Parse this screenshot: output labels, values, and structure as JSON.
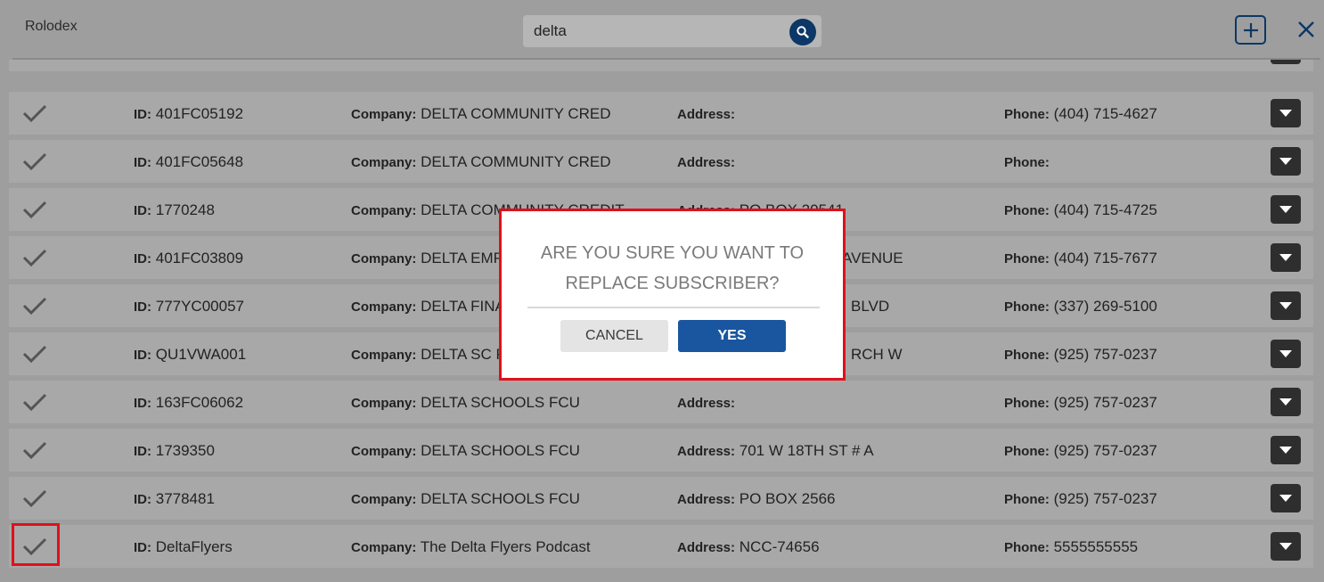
{
  "header": {
    "title": "Rolodex",
    "search_value": "delta"
  },
  "labels": {
    "id": "ID:",
    "company": "Company:",
    "address": "Address:",
    "phone": "Phone:"
  },
  "rows": [
    {
      "id": "",
      "company": "",
      "address": "",
      "phone": "(...)"
    },
    {
      "id": "401FC05192",
      "company": "DELTA COMMUNITY CRED",
      "address": "",
      "phone": "(404) 715-4627"
    },
    {
      "id": "401FC05648",
      "company": "DELTA COMMUNITY CRED",
      "address": "",
      "phone": ""
    },
    {
      "id": "1770248",
      "company": "DELTA COMMUNITY CREDIT",
      "address": "PO BOX 20541",
      "phone": "(404) 715-4725"
    },
    {
      "id": "401FC03809",
      "company": "DELTA EMPL",
      "address": "AVENUE",
      "phone": "(404) 715-7677"
    },
    {
      "id": "777YC00057",
      "company": "DELTA FINAN",
      "address": "BLVD",
      "phone": "(337) 269-5100"
    },
    {
      "id": "QU1VWA001",
      "company": "DELTA SC FC",
      "address": "RCH W",
      "phone": "(925) 757-0237"
    },
    {
      "id": "163FC06062",
      "company": "DELTA SCHOOLS FCU",
      "address": "",
      "phone": "(925) 757-0237"
    },
    {
      "id": "1739350",
      "company": "DELTA SCHOOLS FCU",
      "address": "701 W 18TH ST # A",
      "phone": "(925) 757-0237"
    },
    {
      "id": "3778481",
      "company": "DELTA SCHOOLS FCU",
      "address": "PO BOX 2566",
      "phone": "(925) 757-0237"
    },
    {
      "id": "DeltaFlyers",
      "company": "The Delta Flyers Podcast",
      "address": "NCC-74656",
      "phone": "5555555555"
    }
  ],
  "modal": {
    "message_line1": "ARE YOU SURE YOU WANT TO",
    "message_line2": "REPLACE SUBSCRIBER?",
    "cancel_label": "CANCEL",
    "yes_label": "YES"
  },
  "colors": {
    "accent": "#0c3766",
    "primary_button": "#1a56a0",
    "highlight": "#e0101a",
    "overlay": "#9e9e9e"
  }
}
